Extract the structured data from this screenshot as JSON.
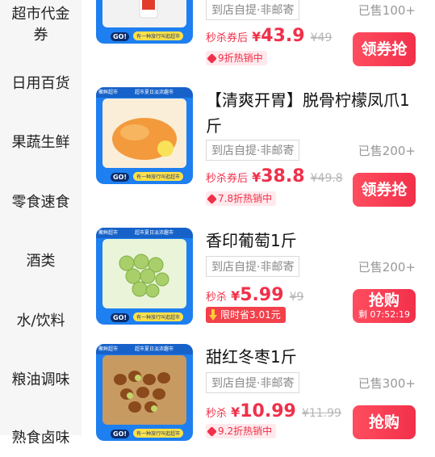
{
  "sidebar": {
    "items": [
      {
        "label": "超市代金",
        "label2": "券"
      },
      {
        "label": "日用百货"
      },
      {
        "label": "果蔬生鲜"
      },
      {
        "label": "零食速食"
      },
      {
        "label": "酒类"
      },
      {
        "label": "水/饮料"
      },
      {
        "label": "粮油调味"
      },
      {
        "label": "熟食卤味"
      }
    ]
  },
  "thumb_text": {
    "brand": "聚鲜超市",
    "headline": "超市夏日淡浓趣市",
    "go": "GO!",
    "slogan": "有一种旅行叫逛超市"
  },
  "products": [
    {
      "pickup": "到店自提·非邮寄",
      "sold": "已售100+",
      "price_label": "秒杀券后",
      "currency": "¥",
      "price": "43.9",
      "orig_price": "¥49",
      "tag": "9折热销中",
      "button": "领券抢",
      "food_color": "#f2f2f2"
    },
    {
      "title": "【清爽开胃】脱骨柠檬凤爪1斤",
      "pickup": "到店自提·非邮寄",
      "sold": "已售200+",
      "price_label": "秒杀券后",
      "currency": "¥",
      "price": "38.8",
      "orig_price": "¥49.8",
      "tag": "7.8折热销中",
      "button": "领券抢",
      "food_color": "#f39a3c"
    },
    {
      "title": "香印葡萄1斤",
      "pickup": "到店自提·非邮寄",
      "sold": "已售200+",
      "price_label": "秒杀",
      "currency": "¥",
      "price": "5.99",
      "orig_price": "¥9",
      "limit_tag": "限时省3.01元",
      "button": "抢购",
      "countdown": "剩 07:52:19",
      "food_color": "#a9cf6a"
    },
    {
      "title": "甜红冬枣1斤",
      "pickup": "到店自提·非邮寄",
      "sold": "已售300+",
      "price_label": "秒杀",
      "currency": "¥",
      "price": "10.99",
      "orig_price": "¥11.99",
      "tag": "9.2折热销中",
      "button": "抢购",
      "food_color": "#a86a2f"
    }
  ]
}
